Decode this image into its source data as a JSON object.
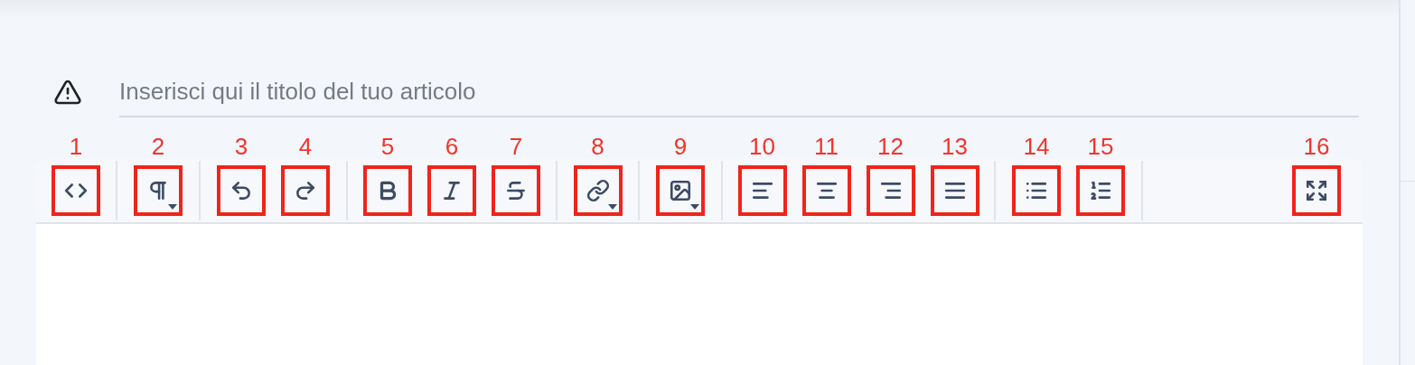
{
  "title_field": {
    "placeholder": "Inserisci qui il titolo del tuo articolo",
    "warning": true
  },
  "toolbar": {
    "groups": [
      {
        "tools": [
          {
            "number": "1",
            "kind": "code",
            "dropdown": false
          }
        ]
      },
      {
        "tools": [
          {
            "number": "2",
            "kind": "paragraph",
            "dropdown": true
          }
        ]
      },
      {
        "tools": [
          {
            "number": "3",
            "kind": "undo",
            "dropdown": false
          },
          {
            "number": "4",
            "kind": "redo",
            "dropdown": false
          }
        ]
      },
      {
        "tools": [
          {
            "number": "5",
            "kind": "bold",
            "dropdown": false
          },
          {
            "number": "6",
            "kind": "italic",
            "dropdown": false
          },
          {
            "number": "7",
            "kind": "strikethrough",
            "dropdown": false
          }
        ]
      },
      {
        "tools": [
          {
            "number": "8",
            "kind": "link",
            "dropdown": true
          }
        ]
      },
      {
        "tools": [
          {
            "number": "9",
            "kind": "image",
            "dropdown": true
          }
        ]
      },
      {
        "tools": [
          {
            "number": "10",
            "kind": "align-left",
            "dropdown": false
          },
          {
            "number": "11",
            "kind": "align-center",
            "dropdown": false
          },
          {
            "number": "12",
            "kind": "align-right",
            "dropdown": false
          },
          {
            "number": "13",
            "kind": "justify",
            "dropdown": false
          }
        ]
      },
      {
        "tools": [
          {
            "number": "14",
            "kind": "bullet-list",
            "dropdown": false
          },
          {
            "number": "15",
            "kind": "numbered-list",
            "dropdown": false
          }
        ]
      },
      {
        "tools": [
          {
            "number": "16",
            "kind": "fullscreen",
            "dropdown": false
          }
        ]
      }
    ]
  }
}
